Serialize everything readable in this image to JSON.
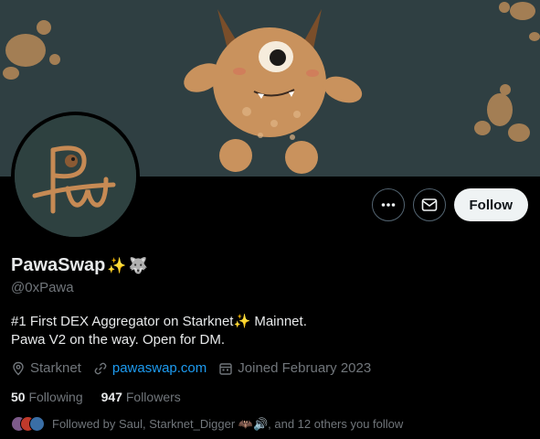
{
  "profile": {
    "display_name": "PawaSwap",
    "name_emojis": [
      "sparkles",
      "wolf"
    ],
    "handle": "@0xPawa",
    "bio": {
      "line1_part1": "#1 First DEX Aggregator on Starknet",
      "line1_part2": " Mainnet.",
      "line2": "Pawa V2 on the way. Open for DM."
    },
    "location": "Starknet",
    "website": "pawaswap.com",
    "joined": "Joined February 2023"
  },
  "stats": {
    "following_count": "50",
    "following_label": "Following",
    "followers_count": "947",
    "followers_label": "Followers"
  },
  "followed_by": {
    "text": "Followed by Saul, Starknet_Digger 🦇🔊, and 12 others you follow"
  },
  "actions": {
    "more_icon": "more-icon",
    "message_icon": "envelope-icon",
    "follow_label": "Follow"
  },
  "colors": {
    "background": "#000000",
    "banner": "#2f3f42",
    "link": "#1d9bf0",
    "muted": "#71767b",
    "text": "#e7e9ea",
    "follow_button": "#eff3f4"
  }
}
